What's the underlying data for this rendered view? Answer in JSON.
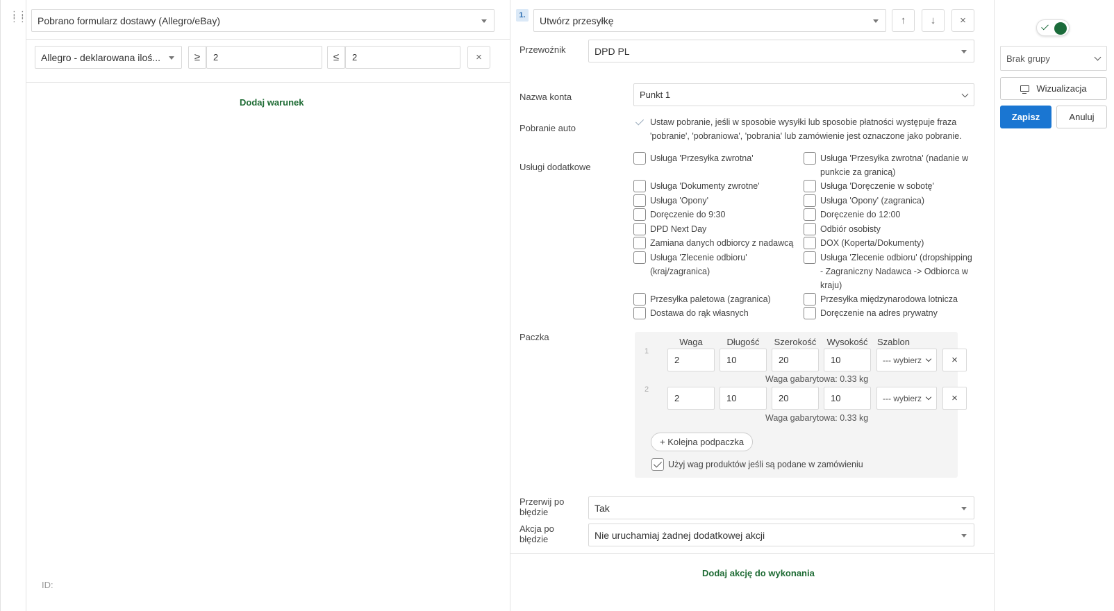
{
  "condition": {
    "trigger_select": "Pobrano formularz dostawy (Allegro/eBay)",
    "rule_field": "Allegro - deklarowana iloś...",
    "gte_symbol": "≥",
    "gte_value": "2",
    "lte_symbol": "≤",
    "lte_value": "2",
    "remove_icon": "×",
    "add_condition_label": "Dodaj warunek",
    "id_label": "ID:"
  },
  "action": {
    "index": "1.",
    "action_select": "Utwórz przesyłkę",
    "move_up_icon": "↑",
    "move_down_icon": "↓",
    "remove_icon": "×",
    "carrier_label": "Przewoźnik",
    "carrier_value": "DPD PL",
    "account_label": "Nazwa konta",
    "account_value": "Punkt 1",
    "cod_label": "Pobranie auto",
    "cod_text_1": "Ustaw pobranie, jeśli w sposobie wysyłki lub sposobie płatności występuje fraza",
    "cod_text_2": "'pobranie', 'pobraniowa', 'pobrania' lub zamówienie jest oznaczone jako pobranie.",
    "services_label": "Usługi dodatkowe",
    "services_left": [
      {
        "l1": "Usługa 'Przesyłka zwrotna'",
        "l2": ""
      },
      {
        "l1": "Usługa 'Dokumenty zwrotne'",
        "l2": ""
      },
      {
        "l1": "Usługa 'Opony'",
        "l2": ""
      },
      {
        "l1": "Doręczenie do 9:30",
        "l2": ""
      },
      {
        "l1": "DPD Next Day",
        "l2": ""
      },
      {
        "l1": "Zamiana danych odbiorcy z nadawcą",
        "l2": ""
      },
      {
        "l1": "Usługa 'Zlecenie odbioru'",
        "l2": "(kraj/zagranica)"
      },
      {
        "l1": "Przesyłka paletowa (zagranica)",
        "l2": ""
      },
      {
        "l1": "Dostawa do rąk własnych",
        "l2": ""
      }
    ],
    "services_right": [
      {
        "l1": "Usługa 'Przesyłka zwrotna' (nadanie w",
        "l2": "punkcie za granicą)",
        "l3": ""
      },
      {
        "l1": "Usługa 'Doręczenie w sobotę'",
        "l2": "",
        "l3": ""
      },
      {
        "l1": "Usługa 'Opony' (zagranica)",
        "l2": "",
        "l3": ""
      },
      {
        "l1": "Doręczenie do 12:00",
        "l2": "",
        "l3": ""
      },
      {
        "l1": "Odbiór osobisty",
        "l2": "",
        "l3": ""
      },
      {
        "l1": "DOX (Koperta/Dokumenty)",
        "l2": "",
        "l3": ""
      },
      {
        "l1": "Usługa 'Zlecenie odbioru' (dropshipping",
        "l2": "- Zagraniczny Nadawca -> Odbiorca w",
        "l3": "kraju)"
      },
      {
        "l1": "Przesyłka międzynarodowa lotnicza",
        "l2": "",
        "l3": ""
      },
      {
        "l1": "Doręczenie na adres prywatny",
        "l2": "",
        "l3": ""
      }
    ],
    "parcel_label": "Paczka",
    "parcel_columns": [
      "Waga",
      "Długość",
      "Szerokość",
      "Wysokość",
      "Szablon"
    ],
    "parcels": [
      {
        "num": "1",
        "weight": "2",
        "length": "10",
        "width": "20",
        "height": "10",
        "template": "--- wybierz",
        "dim_weight": "Waga gabarytowa: 0.33 kg"
      },
      {
        "num": "2",
        "weight": "2",
        "length": "10",
        "width": "20",
        "height": "10",
        "template": "--- wybierz",
        "dim_weight": "Waga gabarytowa: 0.33 kg"
      }
    ],
    "parcel_remove_icon": "×",
    "add_subparcel_label": "+ Kolejna podpaczka",
    "use_product_weights_label": "Użyj wag produktów jeśli są podane w zamówieniu",
    "stop_on_error_label_1": "Przerwij po",
    "stop_on_error_label_2": "błędzie",
    "stop_on_error_value": "Tak",
    "on_error_label_1": "Akcja po",
    "on_error_label_2": "błędzie",
    "on_error_value": "Nie uruchamiaj żadnej dodatkowej akcji",
    "add_action_label": "Dodaj akcję do wykonania"
  },
  "sidebar": {
    "group_select": "Brak grupy",
    "visualize_label": "Wizualizacja",
    "save_label": "Zapisz",
    "cancel_label": "Anuluj"
  }
}
